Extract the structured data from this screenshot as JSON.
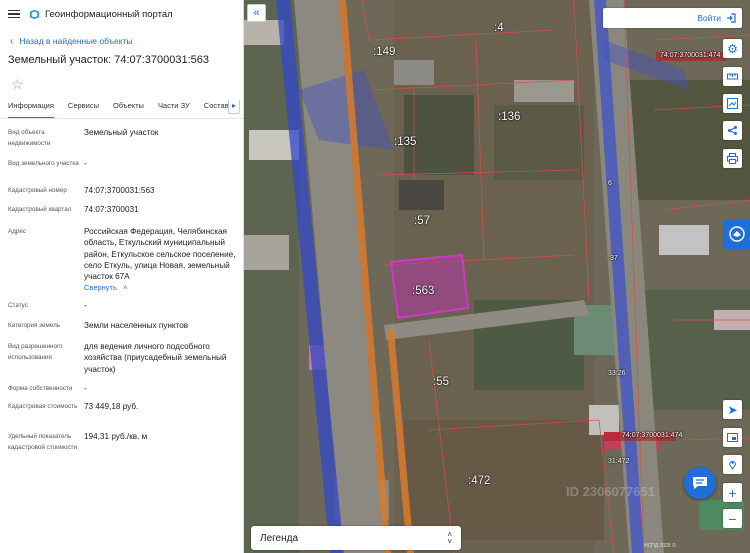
{
  "header": {
    "portal_title": "Геоинформационный портал"
  },
  "nav": {
    "back_label": "Назад в найденные объекты"
  },
  "object": {
    "title": "Земельный участок: 74:07:3700031:563"
  },
  "tabs": [
    {
      "label": "Информация",
      "active": true
    },
    {
      "label": "Сервисы"
    },
    {
      "label": "Объекты"
    },
    {
      "label": "Части ЗУ"
    },
    {
      "label": "Состав"
    }
  ],
  "attributes": [
    {
      "label": "Вид объекта недвижимости",
      "value": "Земельный участок"
    },
    {
      "label": "Вид земельного участка",
      "value": "-"
    },
    {
      "label": "Кадастровый номер",
      "value": "74:07:3700031:563"
    },
    {
      "label": "Кадастровый квартал",
      "value": "74:07:3700031"
    },
    {
      "label": "Адрес",
      "value": "Российская Федерация, Челябинская область, Еткульский муниципальный район, Еткульское сельское поселение, село Еткуль, улица Новая, земельный участок 67А",
      "action": "Свернуть"
    },
    {
      "label": "Статус",
      "value": "-"
    },
    {
      "label": "Категория земель",
      "value": "Земли населенных пунктов"
    },
    {
      "label": "Вид разрешенного использования",
      "value": "для ведения личного подсобного хозяйства (приусадебный земельный участок)"
    },
    {
      "label": "Форма собственности",
      "value": "-"
    },
    {
      "label": "Кадастровая стоимость",
      "value": "73 449,18 руб."
    },
    {
      "label": "Удельный показатель кадастровой стоимости",
      "value": "194,31 руб./кв. м"
    }
  ],
  "map": {
    "login_label": "Войти",
    "legend_label": "Легенда",
    "parcel_labels": [
      ":149",
      ":4",
      ":136",
      ":135",
      ":57",
      ":563",
      ":55",
      ":472"
    ],
    "small_labels": [
      "74:07:3700031:474",
      "74:07:3700031:474",
      "6",
      "37",
      "33:26",
      "31:472"
    ],
    "watermark": "ID 2306077651",
    "copyright": "НСПД 2025 ©",
    "accent_color": "#1e6fd9",
    "selected_parcel_color": "#c030b8"
  },
  "icons": {
    "menu": "burger-menu-icon",
    "logo": "portal-logo-icon",
    "back": "chevron-left-icon",
    "favorite": "star-icon",
    "collapse_panel": "double-chevron-left-icon",
    "login": "login-icon",
    "map_tools": [
      "gear-icon",
      "ruler-icon",
      "image-edit-icon",
      "share-icon",
      "print-icon"
    ],
    "map_nav": [
      "locate-icon",
      "layers-icon",
      "location-pin-icon",
      "zoom-in-icon",
      "zoom-out-icon"
    ],
    "chat": "chat-icon"
  }
}
